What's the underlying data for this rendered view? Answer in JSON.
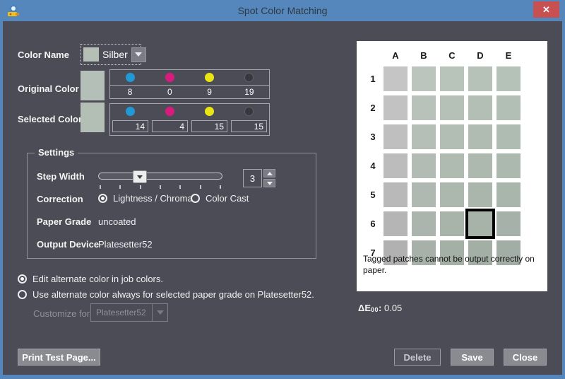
{
  "window": {
    "title": "Spot Color Matching",
    "close_glyph": "✕"
  },
  "color_name": {
    "label": "Color Name",
    "value": "Silber",
    "swatch_color": "#b5bfb5"
  },
  "original_color": {
    "label": "Original Color",
    "swatch_color": "#b4c0b7",
    "channels": [
      {
        "name": "cyan",
        "color": "#2199d4",
        "value": "8"
      },
      {
        "name": "magenta",
        "color": "#d91b7e",
        "value": "0"
      },
      {
        "name": "yellow",
        "color": "#e9e414",
        "value": "9"
      },
      {
        "name": "black",
        "color": "#37383e",
        "value": "19"
      }
    ]
  },
  "selected_color": {
    "label": "Selected Color",
    "swatch_color": "#b3bfb5",
    "channels": [
      {
        "name": "cyan",
        "color": "#2199d4",
        "value": "14"
      },
      {
        "name": "magenta",
        "color": "#d91b7e",
        "value": "4"
      },
      {
        "name": "yellow",
        "color": "#e9e414",
        "value": "15"
      },
      {
        "name": "black",
        "color": "#37383e",
        "value": "15"
      }
    ]
  },
  "settings": {
    "legend": "Settings",
    "step_width": {
      "label": "Step Width",
      "value": "3",
      "tick_count": 7
    },
    "correction": {
      "label": "Correction",
      "options": [
        {
          "label": "Lightness / Chroma",
          "selected": true
        },
        {
          "label": "Color Cast",
          "selected": false
        }
      ]
    },
    "paper_grade": {
      "label": "Paper Grade",
      "value": "uncoated"
    },
    "output_device": {
      "label": "Output Device",
      "value": "Platesetter52"
    }
  },
  "alternate_options": [
    {
      "label": "Edit alternate color in job colors.",
      "selected": true
    },
    {
      "label": "Use alternate color always for selected paper grade on Platesetter52.",
      "selected": false
    }
  ],
  "customize_for": {
    "label": "Customize for",
    "value": "Platesetter52",
    "enabled": false
  },
  "patch_grid": {
    "columns": [
      "A",
      "B",
      "C",
      "D",
      "E"
    ],
    "rows": [
      "1",
      "2",
      "3",
      "4",
      "5",
      "6",
      "7"
    ],
    "selected_cell": "D6",
    "note": "Tagged patches cannot be output correctly on paper.",
    "cell_colors": [
      [
        "#c5c5c5",
        "#bcc5bd",
        "#b8c3ba",
        "#b6c2b8",
        "#b5c2b8"
      ],
      [
        "#c2c2c2",
        "#b9c2ba",
        "#b5c0b7",
        "#b3bfb5",
        "#b2bfb5"
      ],
      [
        "#bfbfbf",
        "#b6bfb7",
        "#b2bdb4",
        "#b0bcb2",
        "#afbcb2"
      ],
      [
        "#bcbcbc",
        "#b3bcb4",
        "#afbab1",
        "#adb9af",
        "#acb9af"
      ],
      [
        "#b9b9b9",
        "#b0b9b1",
        "#acb7ae",
        "#aab6ac",
        "#a9b6ac"
      ],
      [
        "#b5b5b5",
        "#acb5ad",
        "#a8b3aa",
        "#a7b2a9",
        "#a6b2a9"
      ],
      [
        "#b1b1b1",
        "#a8b1a9",
        "#a4afa6",
        "#a3aea5",
        "#a2aea5"
      ]
    ]
  },
  "delta_e": {
    "label": "ΔE",
    "subscript": "00",
    "separator": ": ",
    "value": "0.05"
  },
  "buttons": {
    "print_test_page": "Print Test Page...",
    "delete": "Delete",
    "save": "Save",
    "close": "Close"
  },
  "colors": {
    "titlebar": "#5587bc",
    "body": "#4b4c55",
    "close_button": "#c75050"
  }
}
